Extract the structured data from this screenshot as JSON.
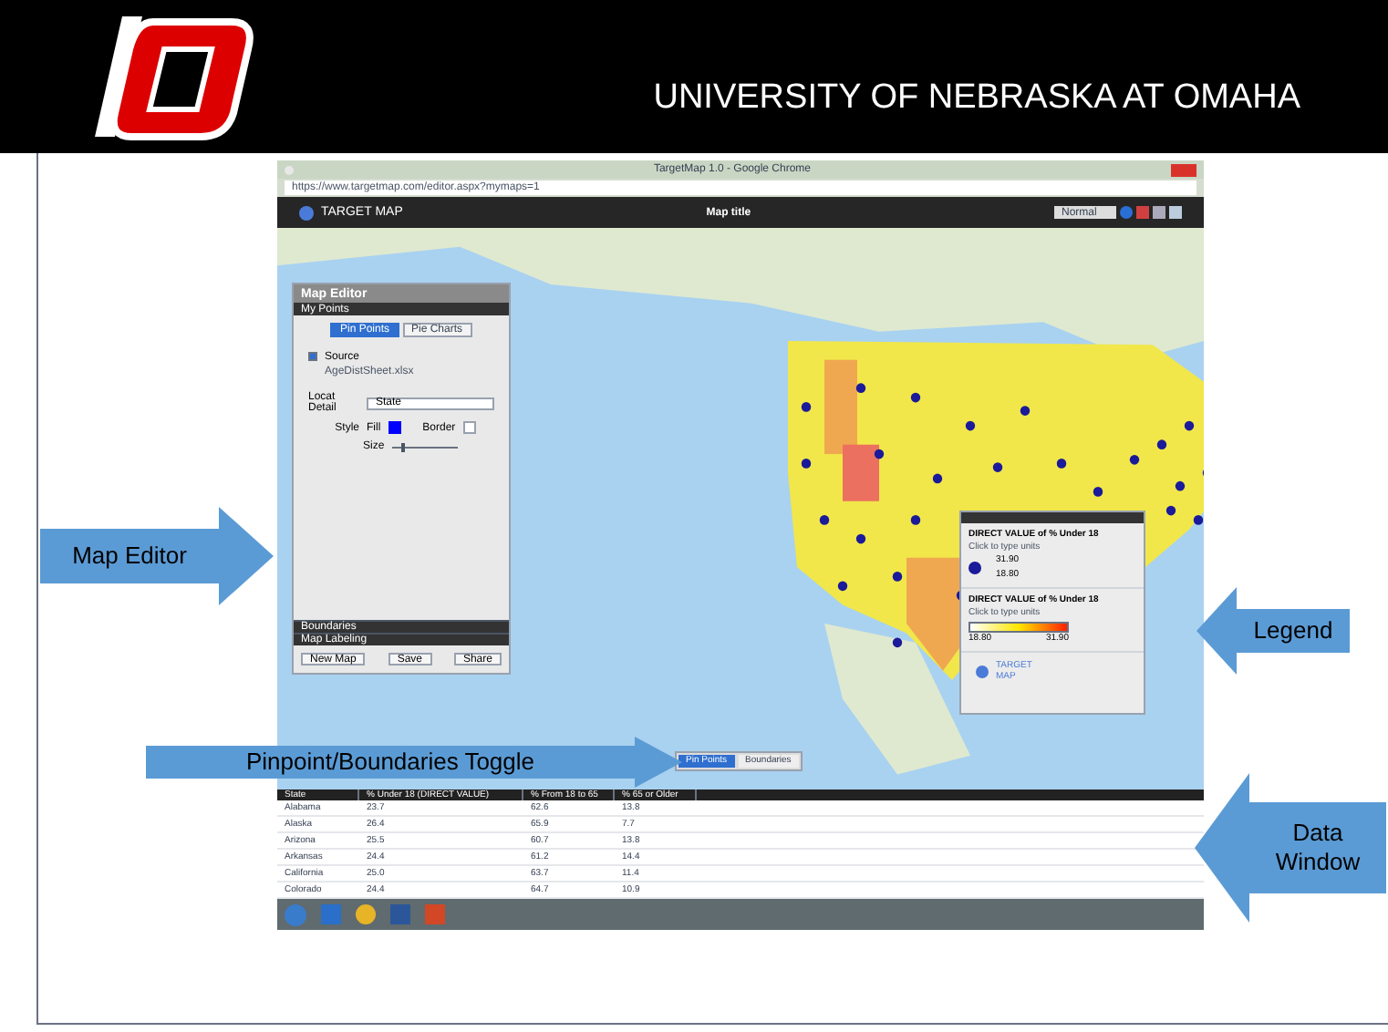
{
  "slide": {
    "title": "UNIVERSITY OF NEBRASKA AT OMAHA"
  },
  "browser": {
    "title": "TargetMap 1.0 - Google Chrome",
    "url": "https://www.targetmap.com/editor.aspx?mymaps=1"
  },
  "app": {
    "brand": "TARGET MAP",
    "map_title": "Map title",
    "view_select": "Normal"
  },
  "editor": {
    "title": "Map Editor",
    "section": "My Points",
    "tabs": [
      {
        "label": "Pin Points",
        "selected": true
      },
      {
        "label": "Pie Charts",
        "selected": false
      }
    ],
    "source": {
      "label": "Source",
      "checked": true,
      "file": "AgeDistSheet.xlsx"
    },
    "locate": {
      "label": "Locat Detail",
      "value": "State"
    },
    "style": {
      "label": "Style",
      "fill_label": "Fill",
      "border_label": "Border",
      "size_label": "Size",
      "level": 0.15
    },
    "sections": [
      "Boundaries",
      "Map Labeling"
    ],
    "buttons": [
      "New Map",
      "Save",
      "Share"
    ]
  },
  "legend": {
    "items": [
      {
        "kind": "points",
        "title": "DIRECT VALUE of % Under 18",
        "hint": "Click to type units",
        "max": "31.90",
        "min": "18.80"
      },
      {
        "kind": "gradient",
        "title": "DIRECT VALUE of % Under 18",
        "hint": "Click to type units",
        "min": "18.80",
        "max": "31.90"
      }
    ],
    "brand": "TARGET MAP"
  },
  "toggle": [
    {
      "label": "Pin Points",
      "selected": true
    },
    {
      "label": "Boundaries",
      "selected": false
    }
  ],
  "table": {
    "columns": [
      "State",
      "% Under 18 (DIRECT VALUE)",
      "% From 18 to 65",
      "% 65 or Older"
    ],
    "rows": [
      [
        "Alabama",
        "23.7",
        "62.6",
        "13.8"
      ],
      [
        "Alaska",
        "26.4",
        "65.9",
        "7.7"
      ],
      [
        "Arizona",
        "25.5",
        "60.7",
        "13.8"
      ],
      [
        "Arkansas",
        "24.4",
        "61.2",
        "14.4"
      ],
      [
        "California",
        "25.0",
        "63.7",
        "11.4"
      ],
      [
        "Colorado",
        "24.4",
        "64.7",
        "10.9"
      ]
    ]
  },
  "callouts": [
    {
      "label": "Map Editor",
      "kind": "right"
    },
    {
      "label": "Legend",
      "kind": "left"
    },
    {
      "label": "Pinpoint/Boundaries Toggle",
      "kind": "right"
    },
    {
      "label": "Data Window",
      "kind": "left"
    }
  ]
}
